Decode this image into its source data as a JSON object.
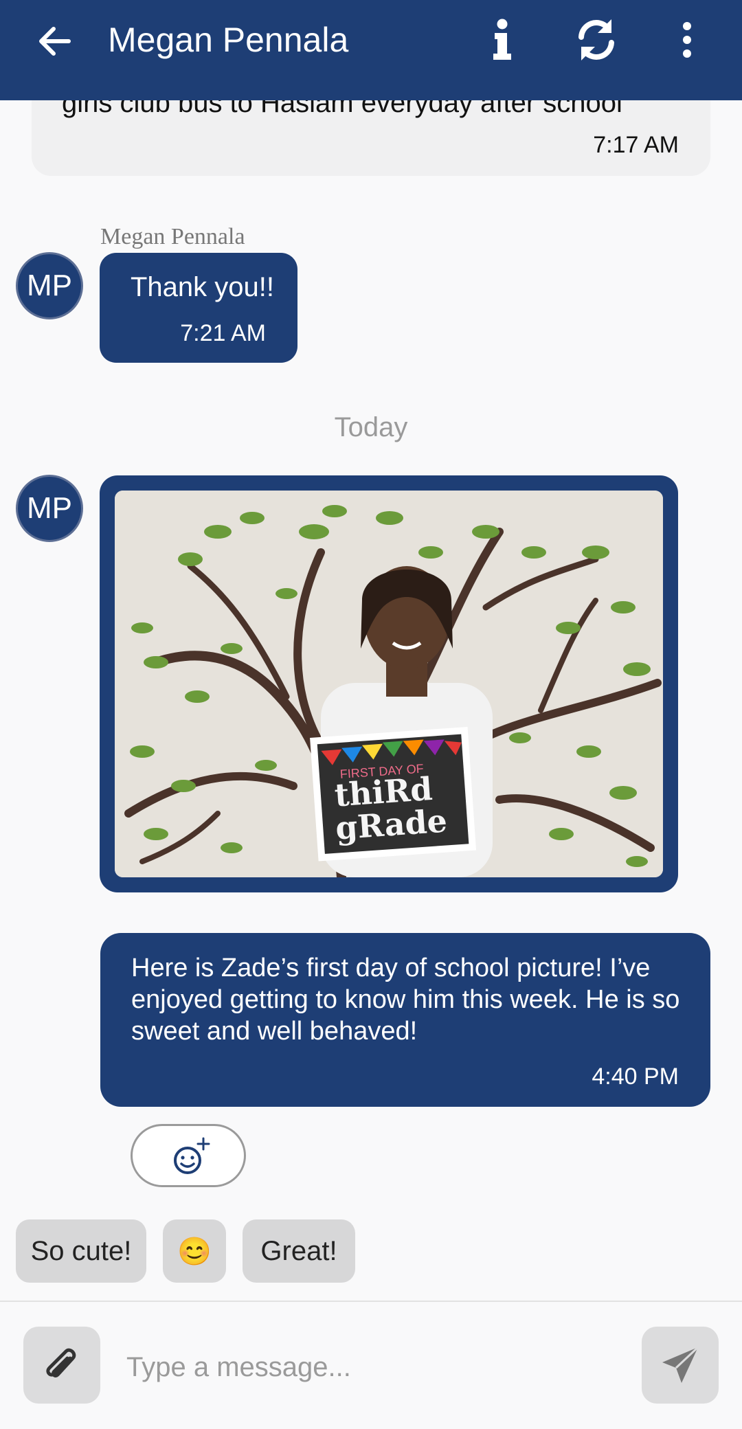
{
  "header": {
    "title": "Megan Pennala",
    "icons": [
      "back-arrow-icon",
      "info-icon",
      "sync-icon",
      "more-vertical-icon"
    ],
    "background": "#1e3e75"
  },
  "messages": {
    "prev_incoming": {
      "text": "girls club bus to Haslam everyday after school",
      "time": "7:17 AM"
    },
    "thank_you": {
      "sender": "Megan Pennala",
      "initials": "MP",
      "text": "Thank you!!",
      "time": "7:21 AM"
    },
    "date_separator": "Today",
    "photo_message": {
      "initials": "MP",
      "image_sign_line1": "FIRST DAY OF",
      "image_sign_line2": "thiRd",
      "image_sign_line3": "gRade"
    },
    "outgoing": {
      "text": "Here is Zade’s first day of school picture! I’ve enjoyed getting to know him this week. He is so sweet and well behaved!",
      "time": "4:40 PM"
    }
  },
  "reaction_button": {
    "icon": "add-reaction-icon"
  },
  "quick_replies": [
    "So cute!",
    "😊",
    "Great!"
  ],
  "composer": {
    "placeholder": "Type a message...",
    "attach_icon": "paperclip-icon",
    "send_icon": "send-icon"
  },
  "colors": {
    "accent": "#1e3e75",
    "chip": "#d7d7d8",
    "muted": "#9a9a9a"
  }
}
